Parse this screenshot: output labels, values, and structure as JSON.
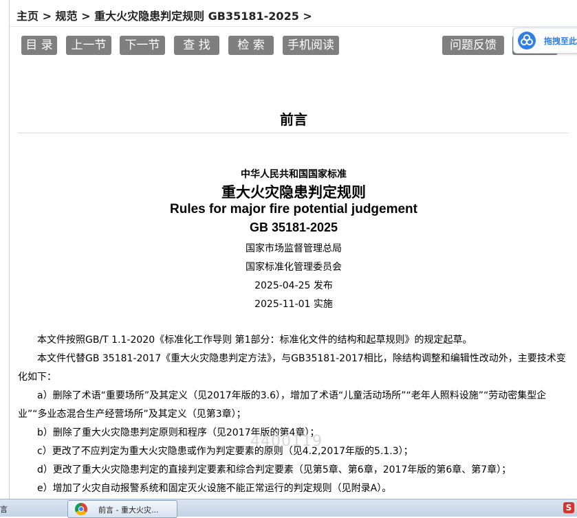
{
  "breadcrumb": "主页 > 规范 > 重大火灾隐患判定规则 GB35181-2025 >",
  "toolbar": {
    "catalog": "目 录",
    "prev": "上一节",
    "next": "下一节",
    "find": "查 找",
    "search": "检 索",
    "mobile": "手机阅读",
    "feedback": "问题反馈"
  },
  "floating_tool": {
    "label": "拖拽至此",
    "icon": "cloud-icon"
  },
  "section_title": "前言",
  "doc": {
    "standard_type": "中华人民共和国国家标准",
    "title_cn": "重大火灾隐患判定规则",
    "title_en": "Rules for major fire potential judgement",
    "code": "GB 35181-2025",
    "issuer1": "国家市场监督管理总局",
    "issuer2": "国家标准化管理委员会",
    "publish": "2025-04-25 发布",
    "implement": "2025-11-01 实施"
  },
  "paragraphs": {
    "p1": "本文件按照GB/T 1.1-2020《标准化工作导则 第1部分：标准化文件的结构和起草规则》的规定起草。",
    "p2": "本文件代替GB 35181-2017《重大火灾隐患判定方法》，与GB35181-2017相比，除结构调整和编辑性改动外，主要技术变化如下：",
    "a": "a）删除了术语“重要场所”及其定义（见2017年版的3.6），增加了术语“儿童活动场所”“老年人照料设施”“劳动密集型企业”“多业态混合生产经营场所”及其定义（见第3章）；",
    "b": "b）删除了重大火灾隐患判定原则和程序（见2017年版的第4章）；",
    "c": "c）更改了不应判定为重大火灾隐患或作为判定要素的原则（见4.2,2017年版的5.1.3）；",
    "d": "d）更改了重大火灾隐患判定的直接判定要素和综合判定要素（见第5章、第6章，2017年版的第6章、第7章）；",
    "e": "e）增加了火灾自动报警系统和固定灭火设施不能正常运行的判定规则（见附录A）。"
  },
  "watermark": "4400119",
  "taskbar": {
    "left_label": "言",
    "item_label": "前言 - 重大火灾...",
    "browser_icon": "chrome-icon",
    "tray_icon": "sogou-icon"
  }
}
